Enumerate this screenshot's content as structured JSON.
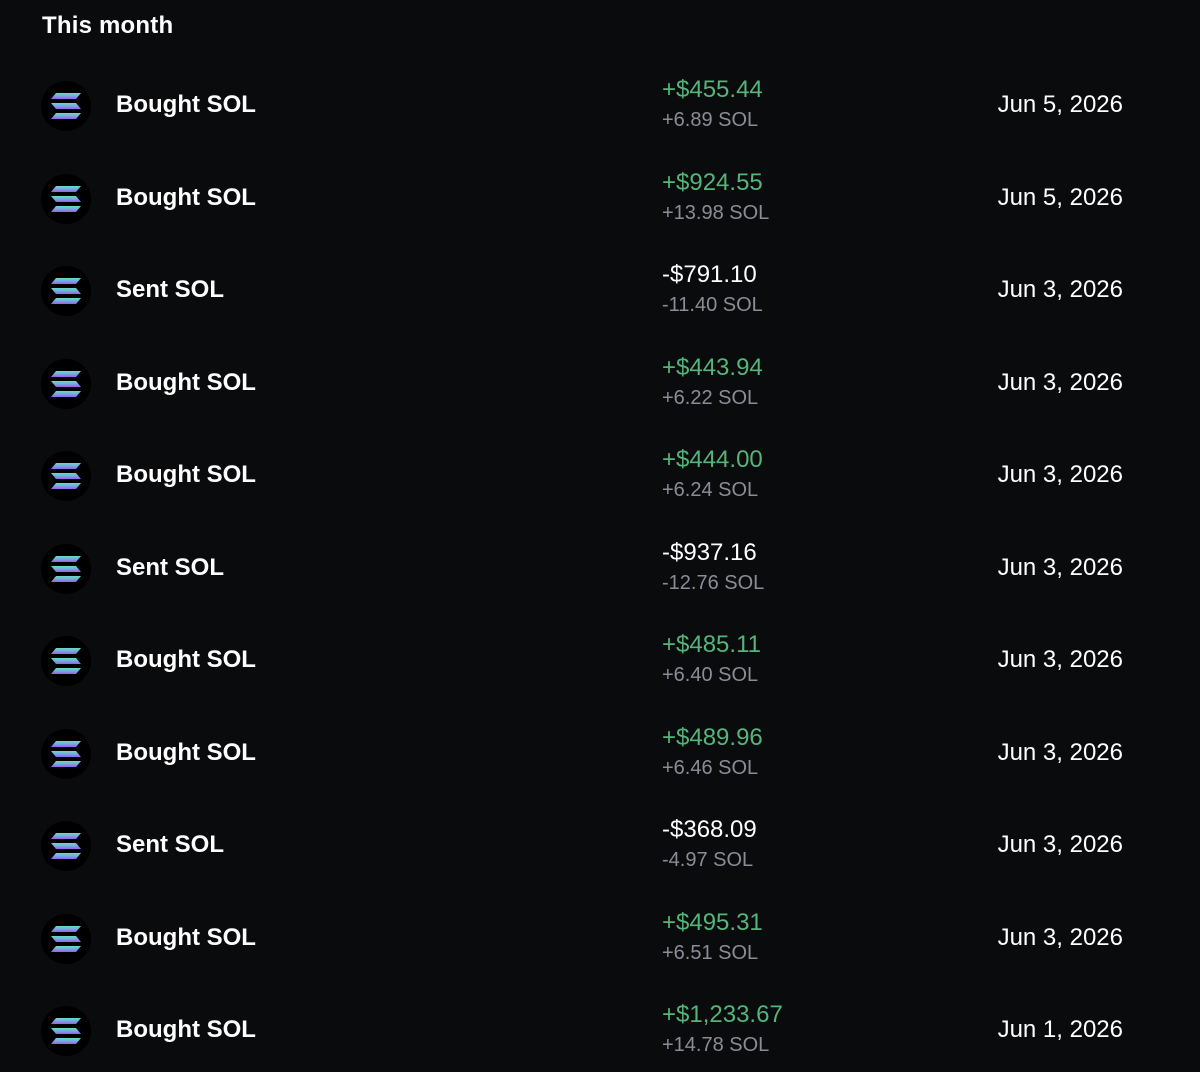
{
  "section": {
    "title": "This month"
  },
  "colors": {
    "background": "#0a0b0d",
    "positive": "#55b47a",
    "secondary_text": "#8a8d95",
    "icon_gradient_top": "#5ee0c0",
    "icon_gradient_bottom": "#9b5cf0"
  },
  "transactions": [
    {
      "icon": "solana-icon",
      "label": "Bought SOL",
      "fiat": "+$455.44",
      "crypto": "+6.89 SOL",
      "date": "Jun 5, 2026",
      "direction": "in"
    },
    {
      "icon": "solana-icon",
      "label": "Bought SOL",
      "fiat": "+$924.55",
      "crypto": "+13.98 SOL",
      "date": "Jun 5, 2026",
      "direction": "in"
    },
    {
      "icon": "solana-icon",
      "label": "Sent SOL",
      "fiat": "-$791.10",
      "crypto": "-11.40 SOL",
      "date": "Jun 3, 2026",
      "direction": "out"
    },
    {
      "icon": "solana-icon",
      "label": "Bought SOL",
      "fiat": "+$443.94",
      "crypto": "+6.22 SOL",
      "date": "Jun 3, 2026",
      "direction": "in"
    },
    {
      "icon": "solana-icon",
      "label": "Bought SOL",
      "fiat": "+$444.00",
      "crypto": "+6.24 SOL",
      "date": "Jun 3, 2026",
      "direction": "in"
    },
    {
      "icon": "solana-icon",
      "label": "Sent SOL",
      "fiat": "-$937.16",
      "crypto": "-12.76 SOL",
      "date": "Jun 3, 2026",
      "direction": "out"
    },
    {
      "icon": "solana-icon",
      "label": "Bought SOL",
      "fiat": "+$485.11",
      "crypto": "+6.40 SOL",
      "date": "Jun 3, 2026",
      "direction": "in"
    },
    {
      "icon": "solana-icon",
      "label": "Bought SOL",
      "fiat": "+$489.96",
      "crypto": "+6.46 SOL",
      "date": "Jun 3, 2026",
      "direction": "in"
    },
    {
      "icon": "solana-icon",
      "label": "Sent SOL",
      "fiat": "-$368.09",
      "crypto": "-4.97 SOL",
      "date": "Jun 3, 2026",
      "direction": "out"
    },
    {
      "icon": "solana-icon",
      "label": "Bought SOL",
      "fiat": "+$495.31",
      "crypto": "+6.51 SOL",
      "date": "Jun 3, 2026",
      "direction": "in"
    },
    {
      "icon": "solana-icon",
      "label": "Bought SOL",
      "fiat": "+$1,233.67",
      "crypto": "+14.78 SOL",
      "date": "Jun 1, 2026",
      "direction": "in"
    }
  ]
}
